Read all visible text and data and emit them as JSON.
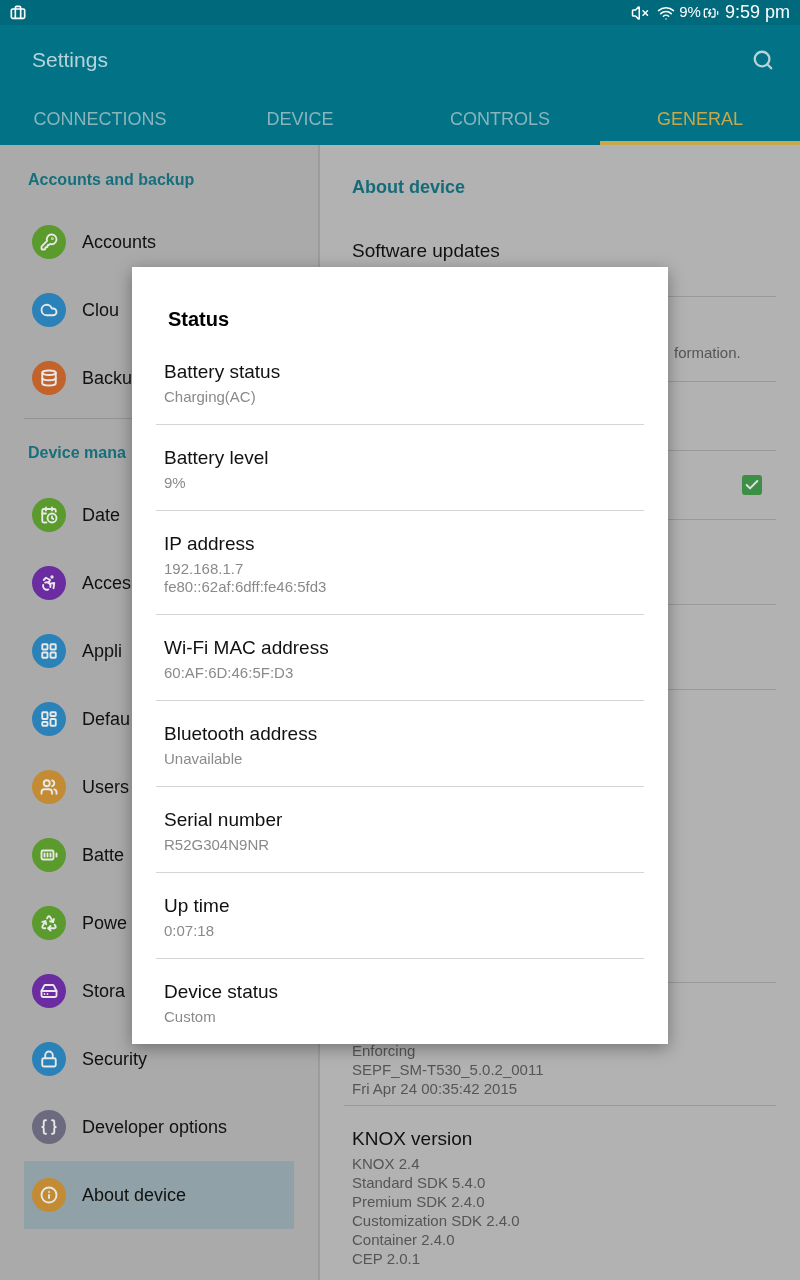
{
  "status_bar": {
    "battery": "9%",
    "time": "9:59 pm"
  },
  "app_bar": {
    "title": "Settings"
  },
  "tabs": [
    {
      "label": "CONNECTIONS",
      "selected": false
    },
    {
      "label": "DEVICE",
      "selected": false
    },
    {
      "label": "CONTROLS",
      "selected": false
    },
    {
      "label": "GENERAL",
      "selected": true
    }
  ],
  "sidebar": {
    "sections": [
      {
        "heading": "Accounts and backup",
        "items": [
          {
            "label": "Accounts",
            "color": "#5b9a2c",
            "selected": false
          },
          {
            "label": "Clou",
            "color": "#2b82b9",
            "selected": false
          },
          {
            "label": "Backu",
            "color": "#c2632b",
            "selected": false
          }
        ]
      },
      {
        "heading": "Device mana",
        "items": [
          {
            "label": "Date",
            "color": "#5b9a2c",
            "selected": false
          },
          {
            "label": "Acces",
            "color": "#6b2ba1",
            "selected": false
          },
          {
            "label": "Appli",
            "color": "#2b82b9",
            "selected": false
          },
          {
            "label": "Defau",
            "color": "#2b82b9",
            "selected": false
          },
          {
            "label": "Users",
            "color": "#c38b33",
            "selected": false
          },
          {
            "label": "Batte",
            "color": "#5b9a2c",
            "selected": false
          },
          {
            "label": "Powe",
            "color": "#5b9a2c",
            "selected": false
          },
          {
            "label": "Stora",
            "color": "#6b2ba1",
            "selected": false
          },
          {
            "label": "Security",
            "color": "#2b82b9",
            "selected": false
          },
          {
            "label": "Developer options",
            "color": "#6c6a7e",
            "selected": false
          },
          {
            "label": "About device",
            "color": "#c38b33",
            "selected": true
          }
        ]
      }
    ]
  },
  "content": {
    "heading": "About device",
    "software_updates": "Software updates",
    "description_fragment": "formation.",
    "checkbox": {
      "checked": true
    },
    "details_lines": [
      "Enforcing",
      "SEPF_SM-T530_5.0.2_0011",
      "Fri Apr 24 00:35:42 2015"
    ],
    "knox": {
      "title": "KNOX version",
      "lines": [
        "KNOX 2.4",
        "Standard SDK 5.4.0",
        "Premium SDK 2.4.0",
        "Customization SDK 2.4.0",
        "Container 2.4.0",
        "CEP 2.0.1"
      ]
    }
  },
  "dialog": {
    "title": "Status",
    "items": [
      {
        "label": "Battery status",
        "values": [
          "Charging(AC)"
        ]
      },
      {
        "label": "Battery level",
        "values": [
          "9%"
        ]
      },
      {
        "label": "IP address",
        "values": [
          "192.168.1.7",
          "fe80::62af:6dff:fe46:5fd3"
        ]
      },
      {
        "label": "Wi-Fi MAC address",
        "values": [
          "60:AF:6D:46:5F:D3"
        ]
      },
      {
        "label": "Bluetooth address",
        "values": [
          "Unavailable"
        ]
      },
      {
        "label": "Serial number",
        "values": [
          "R52G304N9NR"
        ]
      },
      {
        "label": "Up time",
        "values": [
          "0:07:18"
        ]
      },
      {
        "label": "Device status",
        "values": [
          "Custom"
        ]
      }
    ]
  }
}
